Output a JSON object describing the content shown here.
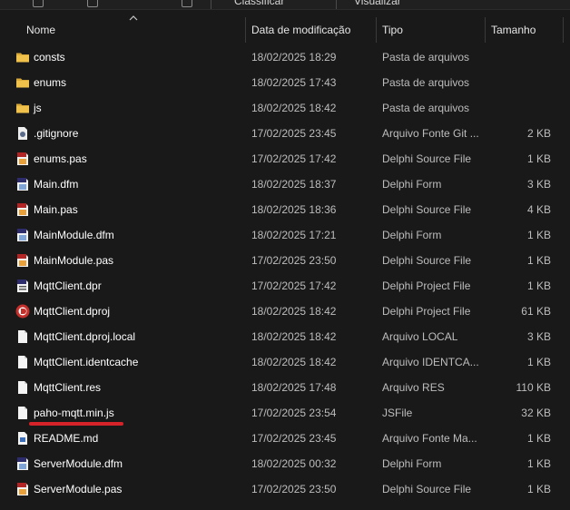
{
  "toolbar": {
    "sort_label": "Classificar",
    "view_label": "Visualizar"
  },
  "columns": {
    "name": "Nome",
    "modified": "Data de modificação",
    "type": "Tipo",
    "size": "Tamanho"
  },
  "files": [
    {
      "name": "consts",
      "modified": "18/02/2025 18:29",
      "type": "Pasta de arquivos",
      "size": "",
      "icon": "folder-icon"
    },
    {
      "name": "enums",
      "modified": "18/02/2025 17:43",
      "type": "Pasta de arquivos",
      "size": "",
      "icon": "folder-icon"
    },
    {
      "name": "js",
      "modified": "18/02/2025 18:42",
      "type": "Pasta de arquivos",
      "size": "",
      "icon": "folder-icon"
    },
    {
      "name": ".gitignore",
      "modified": "17/02/2025 23:45",
      "type": "Arquivo Fonte Git ...",
      "size": "2 KB",
      "icon": "git-file-icon"
    },
    {
      "name": "enums.pas",
      "modified": "17/02/2025 17:42",
      "type": "Delphi Source File",
      "size": "1 KB",
      "icon": "pas-file-icon"
    },
    {
      "name": "Main.dfm",
      "modified": "18/02/2025 18:37",
      "type": "Delphi Form",
      "size": "3 KB",
      "icon": "dfm-file-icon"
    },
    {
      "name": "Main.pas",
      "modified": "18/02/2025 18:36",
      "type": "Delphi Source File",
      "size": "4 KB",
      "icon": "pas-file-icon"
    },
    {
      "name": "MainModule.dfm",
      "modified": "18/02/2025 17:21",
      "type": "Delphi Form",
      "size": "1 KB",
      "icon": "dfm-file-icon"
    },
    {
      "name": "MainModule.pas",
      "modified": "17/02/2025 23:50",
      "type": "Delphi Source File",
      "size": "1 KB",
      "icon": "pas-file-icon"
    },
    {
      "name": "MqttClient.dpr",
      "modified": "17/02/2025 17:42",
      "type": "Delphi Project File",
      "size": "1 KB",
      "icon": "dpr-file-icon"
    },
    {
      "name": "MqttClient.dproj",
      "modified": "18/02/2025 18:42",
      "type": "Delphi Project File",
      "size": "61 KB",
      "icon": "delphi-project-icon"
    },
    {
      "name": "MqttClient.dproj.local",
      "modified": "18/02/2025 18:42",
      "type": "Arquivo LOCAL",
      "size": "3 KB",
      "icon": "blank-file-icon"
    },
    {
      "name": "MqttClient.identcache",
      "modified": "18/02/2025 18:42",
      "type": "Arquivo IDENTCA...",
      "size": "1 KB",
      "icon": "blank-file-icon"
    },
    {
      "name": "MqttClient.res",
      "modified": "18/02/2025 17:48",
      "type": "Arquivo RES",
      "size": "110 KB",
      "icon": "blank-file-icon"
    },
    {
      "name": "paho-mqtt.min.js",
      "modified": "17/02/2025 23:54",
      "type": "JSFile",
      "size": "32 KB",
      "icon": "blank-file-icon"
    },
    {
      "name": "README.md",
      "modified": "17/02/2025 23:45",
      "type": "Arquivo Fonte Ma...",
      "size": "1 KB",
      "icon": "markdown-file-icon"
    },
    {
      "name": "ServerModule.dfm",
      "modified": "18/02/2025 00:32",
      "type": "Delphi Form",
      "size": "1 KB",
      "icon": "dfm-file-icon"
    },
    {
      "name": "ServerModule.pas",
      "modified": "17/02/2025 23:50",
      "type": "Delphi Source File",
      "size": "1 KB",
      "icon": "pas-file-icon"
    }
  ],
  "colors": {
    "background": "#191919",
    "folder": "#f0c14b",
    "annotation": "#d6232a",
    "delphi_red": "#c4302b"
  }
}
